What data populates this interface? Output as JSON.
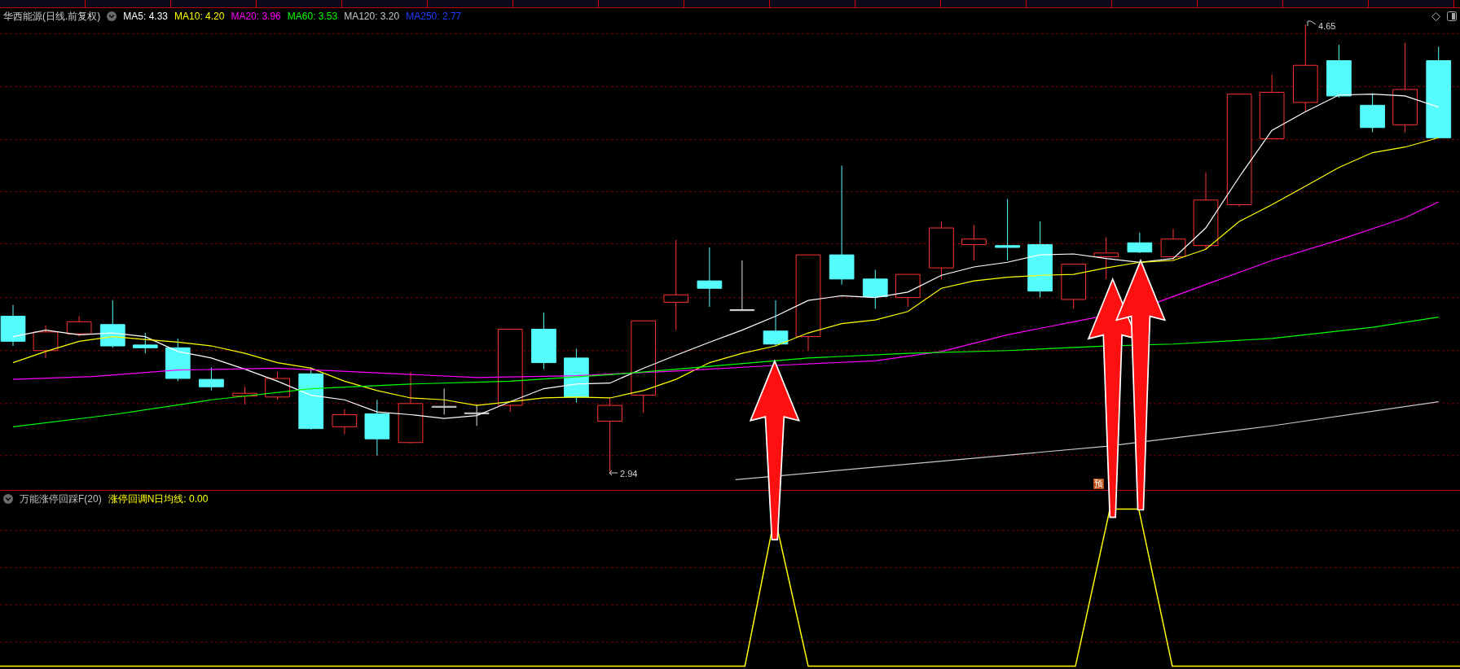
{
  "main_panel": {
    "title": "华西能源(日线.前复权)",
    "indicators": [
      {
        "label": "MA5: 4.33",
        "color": "#ffffff"
      },
      {
        "label": "MA10: 4.20",
        "color": "#ffff00"
      },
      {
        "label": "MA20: 3.96",
        "color": "#ff00ff"
      },
      {
        "label": "MA60: 3.53",
        "color": "#00ff00"
      },
      {
        "label": "MA120: 3.20",
        "color": "#c8c8c8"
      },
      {
        "label": "MA250: 2.77",
        "color": "#1f3cff"
      }
    ],
    "high_label": "4.65",
    "low_label": "2.94",
    "signal_badge": "预"
  },
  "sub_panel": {
    "title": "万能涨停回踩F(20)",
    "indicators": [
      {
        "label": "涨停回调N日均线: 0.00",
        "color": "#ffff00"
      }
    ]
  }
}
